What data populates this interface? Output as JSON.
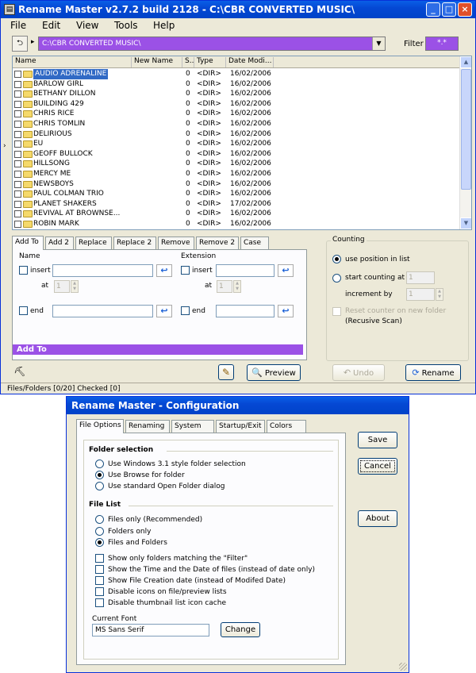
{
  "main": {
    "title": "Rename Master v2.7.2 build 2128 - C:\\CBR CONVERTED MUSIC\\",
    "title_buttons": {
      "minimize": "_",
      "maximize": "□",
      "close": "×"
    },
    "menu": [
      "File",
      "Edit",
      "View",
      "Tools",
      "Help"
    ],
    "path": "C:\\CBR CONVERTED MUSIC\\",
    "filter_label": "Filter",
    "filter_value": "*.*",
    "columns": [
      "Name",
      "New Name",
      "S..",
      "Type",
      "Date Modi..."
    ],
    "rows": [
      {
        "name": "AUDIO ADRENALINE",
        "size": "0",
        "type": "<DIR>",
        "date": "16/02/2006"
      },
      {
        "name": "BARLOW GIRL",
        "size": "0",
        "type": "<DIR>",
        "date": "16/02/2006"
      },
      {
        "name": "BETHANY DILLON",
        "size": "0",
        "type": "<DIR>",
        "date": "16/02/2006"
      },
      {
        "name": "BUILDING 429",
        "size": "0",
        "type": "<DIR>",
        "date": "16/02/2006"
      },
      {
        "name": "CHRIS RICE",
        "size": "0",
        "type": "<DIR>",
        "date": "16/02/2006"
      },
      {
        "name": "CHRIS TOMLIN",
        "size": "0",
        "type": "<DIR>",
        "date": "16/02/2006"
      },
      {
        "name": "DELIRIOUS",
        "size": "0",
        "type": "<DIR>",
        "date": "16/02/2006"
      },
      {
        "name": "EU",
        "size": "0",
        "type": "<DIR>",
        "date": "16/02/2006"
      },
      {
        "name": "GEOFF BULLOCK",
        "size": "0",
        "type": "<DIR>",
        "date": "16/02/2006"
      },
      {
        "name": "HILLSONG",
        "size": "0",
        "type": "<DIR>",
        "date": "16/02/2006"
      },
      {
        "name": "MERCY ME",
        "size": "0",
        "type": "<DIR>",
        "date": "16/02/2006"
      },
      {
        "name": "NEWSBOYS",
        "size": "0",
        "type": "<DIR>",
        "date": "16/02/2006"
      },
      {
        "name": "PAUL COLMAN TRIO",
        "size": "0",
        "type": "<DIR>",
        "date": "16/02/2006"
      },
      {
        "name": "PLANET SHAKERS",
        "size": "0",
        "type": "<DIR>",
        "date": "17/02/2006"
      },
      {
        "name": "REVIVAL AT BROWNSE...",
        "size": "0",
        "type": "<DIR>",
        "date": "16/02/2006"
      },
      {
        "name": "ROBIN MARK",
        "size": "0",
        "type": "<DIR>",
        "date": "16/02/2006"
      }
    ],
    "tabs": [
      "Add To",
      "Add 2",
      "Replace",
      "Replace 2",
      "Remove",
      "Remove 2",
      "Case"
    ],
    "addto": {
      "name_label": "Name",
      "extension_label": "Extension",
      "insert_label": "insert",
      "at_label": "at",
      "at_value": "1",
      "end_label": "end",
      "banner": "Add To"
    },
    "counting": {
      "title": "Counting",
      "use_position": "use position in list",
      "start_counting": "start counting at",
      "start_value": "1",
      "increment_by": "increment by",
      "increment_value": "1",
      "reset_counter": "Reset counter on new folder",
      "recursive": "(Recusive Scan)"
    },
    "buttons": {
      "preview": "Preview",
      "undo": "Undo",
      "rename": "Rename"
    },
    "status": "Files/Folders [0/20] Checked [0]"
  },
  "config": {
    "title": "Rename Master - Configuration",
    "tabs": [
      "File Options",
      "Renaming",
      "System",
      "Startup/Exit",
      "Colors"
    ],
    "folder_selection": {
      "heading": "Folder selection",
      "options": [
        "Use Windows 3.1 style folder selection",
        "Use Browse for folder",
        "Use standard Open Folder dialog"
      ]
    },
    "file_list": {
      "heading": "File List",
      "radios": [
        "Files only  (Recommended)",
        "Folders only",
        "Files and Folders"
      ],
      "checks": [
        "Show only folders matching the \"Filter\"",
        "Show the Time and the Date of files (instead of date only)",
        "Show File Creation date (instead of Modifed Date)",
        "Disable icons on file/preview lists",
        "Disable thumbnail list icon cache"
      ]
    },
    "current_font_label": "Current Font",
    "current_font_value": "MS Sans Serif",
    "buttons": {
      "change": "Change",
      "save": "Save",
      "cancel": "Cancel",
      "about": "About"
    }
  }
}
